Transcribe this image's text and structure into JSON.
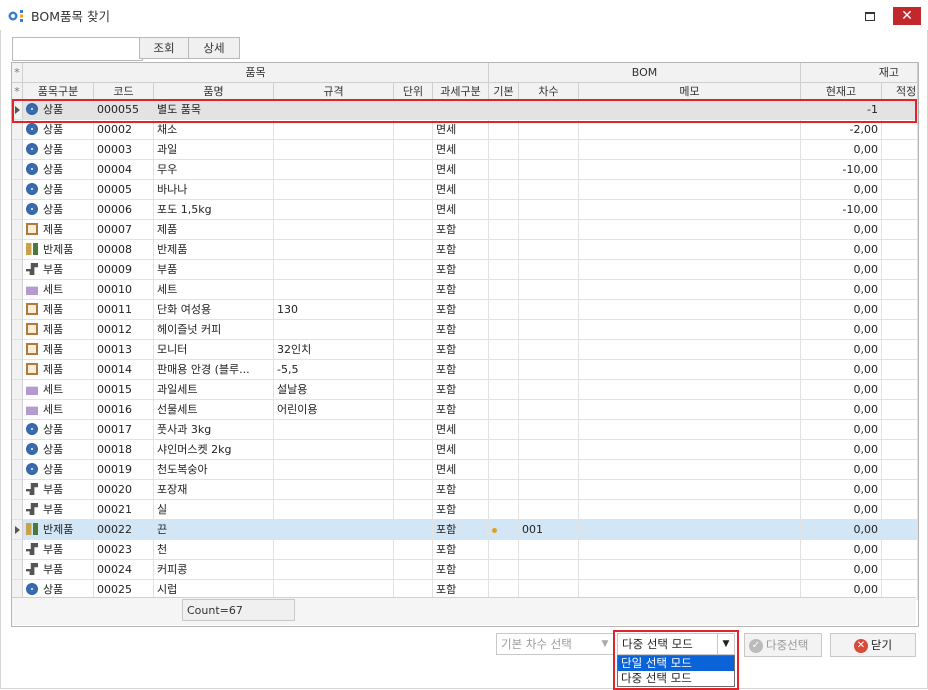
{
  "window": {
    "title": "BOM품목 찾기",
    "close_label": "✕"
  },
  "toolbar": {
    "search_value": "",
    "query_label": "조회",
    "detail_label": "상세"
  },
  "header": {
    "asterisk": "*",
    "group_item": "품목",
    "group_bom": "BOM",
    "group_stock": "재고",
    "columns": [
      "품목구분",
      "코드",
      "품명",
      "규격",
      "단위",
      "과세구분",
      "기본",
      "차수",
      "메모",
      "현재고",
      "적정"
    ]
  },
  "rows": [
    {
      "type": "상품",
      "icon": "circle-icon",
      "code": "000055",
      "name": "별도 품목",
      "spec": "",
      "unit": "",
      "tax": "",
      "basic": "",
      "ver": "",
      "memo": "",
      "stock": "-1"
    },
    {
      "type": "상품",
      "icon": "circle-icon",
      "code": "00002",
      "name": "채소",
      "spec": "",
      "unit": "",
      "tax": "면세",
      "basic": "",
      "ver": "",
      "memo": "",
      "stock": "-2,00"
    },
    {
      "type": "상품",
      "icon": "circle-icon",
      "code": "00003",
      "name": "과일",
      "spec": "",
      "unit": "",
      "tax": "면세",
      "basic": "",
      "ver": "",
      "memo": "",
      "stock": "0,00"
    },
    {
      "type": "상품",
      "icon": "circle-icon",
      "code": "00004",
      "name": "무우",
      "spec": "",
      "unit": "",
      "tax": "면세",
      "basic": "",
      "ver": "",
      "memo": "",
      "stock": "-10,00"
    },
    {
      "type": "상품",
      "icon": "circle-icon",
      "code": "00005",
      "name": "바나나",
      "spec": "",
      "unit": "",
      "tax": "면세",
      "basic": "",
      "ver": "",
      "memo": "",
      "stock": "0,00"
    },
    {
      "type": "상품",
      "icon": "circle-icon",
      "code": "00006",
      "name": "포도 1,5kg",
      "spec": "",
      "unit": "",
      "tax": "면세",
      "basic": "",
      "ver": "",
      "memo": "",
      "stock": "-10,00"
    },
    {
      "type": "제품",
      "icon": "chip-icon",
      "code": "00007",
      "name": "제품",
      "spec": "",
      "unit": "",
      "tax": "포함",
      "basic": "",
      "ver": "",
      "memo": "",
      "stock": "0,00"
    },
    {
      "type": "반제품",
      "icon": "half-product-icon",
      "code": "00008",
      "name": "반제품",
      "spec": "",
      "unit": "",
      "tax": "포함",
      "basic": "",
      "ver": "",
      "memo": "",
      "stock": "0,00"
    },
    {
      "type": "부품",
      "icon": "part-icon",
      "code": "00009",
      "name": "부품",
      "spec": "",
      "unit": "",
      "tax": "포함",
      "basic": "",
      "ver": "",
      "memo": "",
      "stock": "0,00"
    },
    {
      "type": "세트",
      "icon": "gift-icon",
      "code": "00010",
      "name": "세트",
      "spec": "",
      "unit": "",
      "tax": "포함",
      "basic": "",
      "ver": "",
      "memo": "",
      "stock": "0,00"
    },
    {
      "type": "제품",
      "icon": "chip-icon",
      "code": "00011",
      "name": "단화 여성용",
      "spec": "130",
      "unit": "",
      "tax": "포함",
      "basic": "",
      "ver": "",
      "memo": "",
      "stock": "0,00"
    },
    {
      "type": "제품",
      "icon": "chip-icon",
      "code": "00012",
      "name": "헤이즐넛 커피",
      "spec": "",
      "unit": "",
      "tax": "포함",
      "basic": "",
      "ver": "",
      "memo": "",
      "stock": "0,00"
    },
    {
      "type": "제품",
      "icon": "chip-icon",
      "code": "00013",
      "name": "모니터",
      "spec": "32인치",
      "unit": "",
      "tax": "포함",
      "basic": "",
      "ver": "",
      "memo": "",
      "stock": "0,00"
    },
    {
      "type": "제품",
      "icon": "chip-icon",
      "code": "00014",
      "name": "판매용 안경 (블루...",
      "spec": "-5,5",
      "unit": "",
      "tax": "포함",
      "basic": "",
      "ver": "",
      "memo": "",
      "stock": "0,00"
    },
    {
      "type": "세트",
      "icon": "gift-icon",
      "code": "00015",
      "name": "과일세트",
      "spec": "설날용",
      "unit": "",
      "tax": "포함",
      "basic": "",
      "ver": "",
      "memo": "",
      "stock": "0,00"
    },
    {
      "type": "세트",
      "icon": "gift-icon",
      "code": "00016",
      "name": "선물세트",
      "spec": "어린이용",
      "unit": "",
      "tax": "포함",
      "basic": "",
      "ver": "",
      "memo": "",
      "stock": "0,00"
    },
    {
      "type": "상품",
      "icon": "circle-icon",
      "code": "00017",
      "name": "풋사과 3kg",
      "spec": "",
      "unit": "",
      "tax": "면세",
      "basic": "",
      "ver": "",
      "memo": "",
      "stock": "0,00"
    },
    {
      "type": "상품",
      "icon": "circle-icon",
      "code": "00018",
      "name": "샤인머스켓 2kg",
      "spec": "",
      "unit": "",
      "tax": "면세",
      "basic": "",
      "ver": "",
      "memo": "",
      "stock": "0,00"
    },
    {
      "type": "상품",
      "icon": "circle-icon",
      "code": "00019",
      "name": "천도복숭아",
      "spec": "",
      "unit": "",
      "tax": "면세",
      "basic": "",
      "ver": "",
      "memo": "",
      "stock": "0,00"
    },
    {
      "type": "부품",
      "icon": "part-icon",
      "code": "00020",
      "name": "포장재",
      "spec": "",
      "unit": "",
      "tax": "포함",
      "basic": "",
      "ver": "",
      "memo": "",
      "stock": "0,00"
    },
    {
      "type": "부품",
      "icon": "part-icon",
      "code": "00021",
      "name": "실",
      "spec": "",
      "unit": "",
      "tax": "포함",
      "basic": "",
      "ver": "",
      "memo": "",
      "stock": "0,00"
    },
    {
      "type": "반제품",
      "icon": "half-product-icon",
      "code": "00022",
      "name": "끈",
      "spec": "",
      "unit": "",
      "tax": "포함",
      "basic": "●",
      "ver": "001",
      "memo": "",
      "stock": "0,00"
    },
    {
      "type": "부품",
      "icon": "part-icon",
      "code": "00023",
      "name": "천",
      "spec": "",
      "unit": "",
      "tax": "포함",
      "basic": "",
      "ver": "",
      "memo": "",
      "stock": "0,00"
    },
    {
      "type": "부품",
      "icon": "part-icon",
      "code": "00024",
      "name": "커피콩",
      "spec": "",
      "unit": "",
      "tax": "포함",
      "basic": "",
      "ver": "",
      "memo": "",
      "stock": "0,00"
    },
    {
      "type": "상품",
      "icon": "circle-icon",
      "code": "00025",
      "name": "시럽",
      "spec": "",
      "unit": "",
      "tax": "포함",
      "basic": "",
      "ver": "",
      "memo": "",
      "stock": "0,00"
    }
  ],
  "footer": {
    "count": "Count=67"
  },
  "bottom": {
    "version_placeholder": "기본 차수 선택",
    "mode_value": "다중 선택 모드",
    "mode_options": [
      "단일 선택 모드",
      "다중 선택 모드"
    ],
    "multi_select_label": "다중선택",
    "close_label": "닫기"
  },
  "colors": {
    "highlight": "#e0242a",
    "focus_row": "#d3e6f6",
    "dropdown_selected": "#0a64d8"
  }
}
